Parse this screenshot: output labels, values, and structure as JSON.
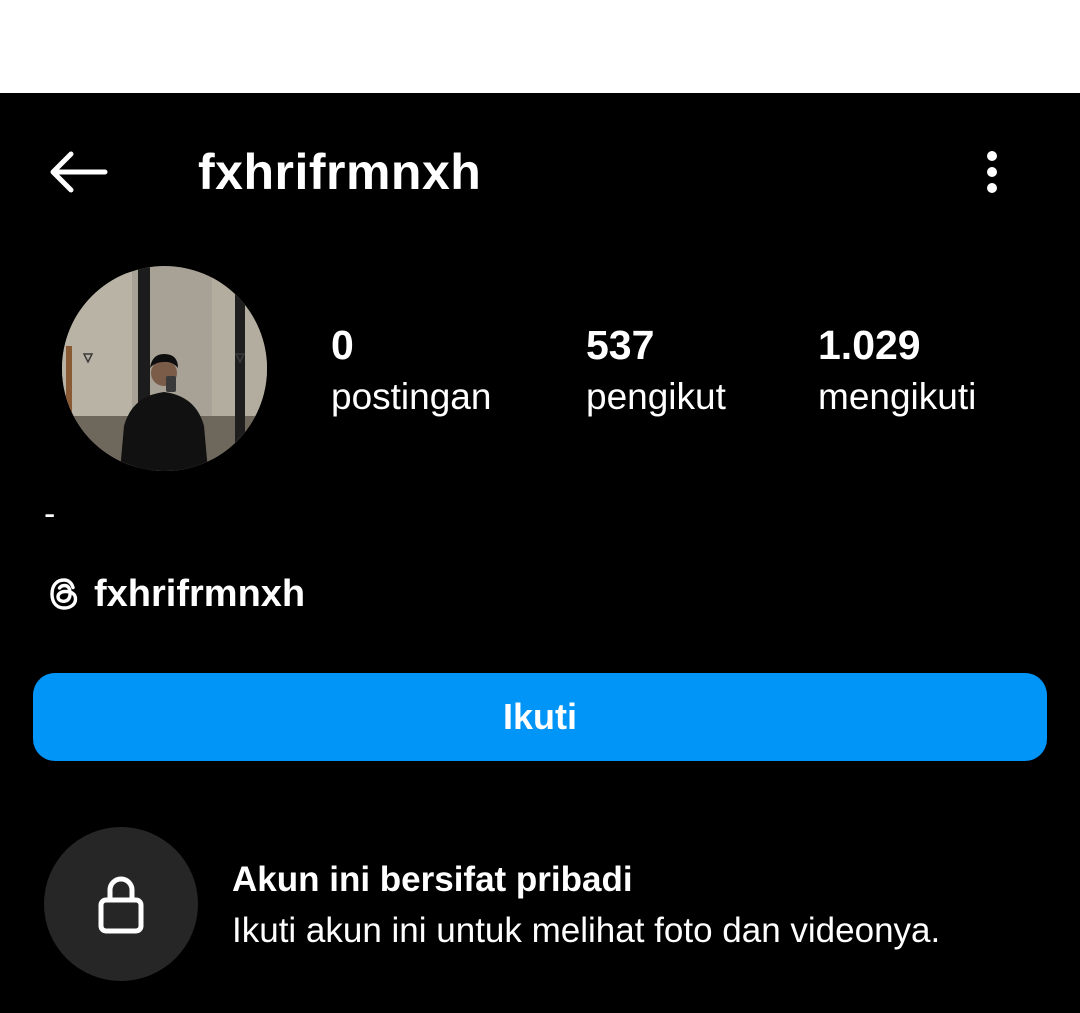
{
  "header": {
    "username": "fxhrifrmnxh",
    "back_icon": "arrow-left-icon",
    "more_icon": "vertical-ellipsis-icon"
  },
  "profile": {
    "stats": {
      "posts": {
        "count": "0",
        "label": "postingan"
      },
      "followers": {
        "count": "537",
        "label": "pengikut"
      },
      "following": {
        "count": "1.029",
        "label": "mengikuti"
      }
    },
    "bio": "-",
    "threads": {
      "icon": "threads-icon",
      "handle": "fxhrifrmnxh"
    }
  },
  "actions": {
    "follow_label": "Ikuti"
  },
  "private_notice": {
    "icon": "lock-icon",
    "title": "Akun ini bersifat pribadi",
    "subtitle": "Ikuti akun ini untuk melihat foto dan videonya."
  },
  "colors": {
    "background": "#000000",
    "primary_button": "#0095f6",
    "lock_circle": "#262626",
    "text": "#ffffff"
  }
}
